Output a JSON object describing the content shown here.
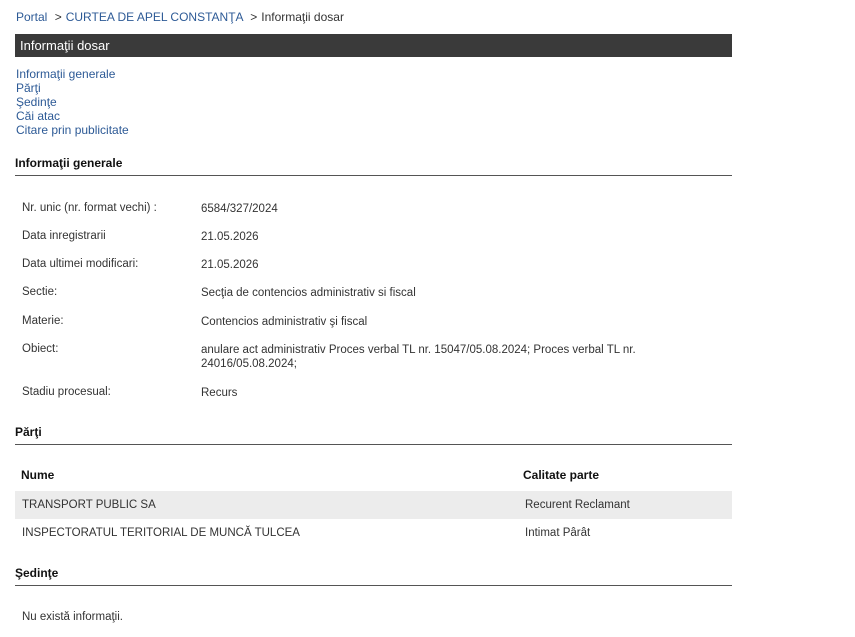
{
  "breadcrumb": {
    "portal": "Portal",
    "separator": ">",
    "court": "CURTEA DE APEL CONSTANŢA",
    "current": "Informaţii dosar"
  },
  "title": "Informaţii dosar",
  "nav": {
    "general": "Informaţii generale",
    "parties": "Părţi",
    "hearings": "Şedinţe",
    "appeals": "Căi atac",
    "summons": "Citare prin publicitate"
  },
  "general": {
    "heading": "Informaţii generale",
    "rows": [
      {
        "label": "Nr. unic (nr. format vechi) :",
        "value": "6584/327/2024"
      },
      {
        "label": "Data inregistrarii",
        "value": "21.05.2026"
      },
      {
        "label": "Data ultimei modificari:",
        "value": "21.05.2026"
      },
      {
        "label": "Sectie:",
        "value": "Secţia de contencios administrativ si fiscal"
      },
      {
        "label": "Materie:",
        "value": "Contencios administrativ şi fiscal"
      },
      {
        "label": "Obiect:",
        "value": "anulare act administrativ Proces verbal TL nr. 15047/05.08.2024; Proces verbal TL nr. 24016/05.08.2024;"
      },
      {
        "label": "Stadiu procesual:",
        "value": "Recurs"
      }
    ]
  },
  "parties": {
    "heading": "Părţi",
    "columns": [
      "Nume",
      "Calitate parte"
    ],
    "rows": [
      {
        "name": "TRANSPORT PUBLIC SA",
        "role": "Recurent Reclamant"
      },
      {
        "name": "INSPECTORATUL TERITORIAL DE MUNCĂ TULCEA",
        "role": "Intimat Pârât"
      }
    ]
  },
  "hearings": {
    "heading": "Şedinţe",
    "empty_text": "Nu există informaţii."
  }
}
